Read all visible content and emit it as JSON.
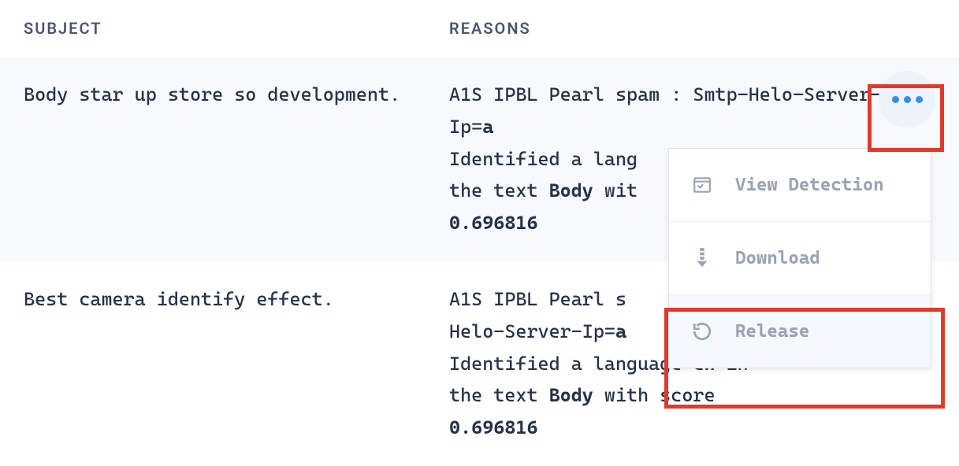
{
  "columns": {
    "subject": "SUBJECT",
    "reasons": "REASONS"
  },
  "rows": [
    {
      "subject": "Body star up store so development.",
      "reason_prefix": "A1S IPBL Pearl spam : Smtp-Helo-Server-Ip=",
      "reason_bold1": "a",
      "reason_mid": " Identified a lang       the text ",
      "reason_bold2": "Body",
      "reason_mid2": " wit        ",
      "reason_bold3": "0.696816"
    },
    {
      "subject": "Best camera identify effect.",
      "reason_prefix": "A1S IPBL Pearl s       Helo-Server-Ip=",
      "reason_bold1": "a",
      "reason_mid": " Identified a language ",
      "reason_boldlang": "cn",
      "reason_mid1b": " in the text ",
      "reason_bold2": "Body",
      "reason_mid2": " with score ",
      "reason_bold3": "0.696816"
    }
  ],
  "dropdown": {
    "view": "View Detection",
    "download": "Download",
    "release": "Release"
  }
}
